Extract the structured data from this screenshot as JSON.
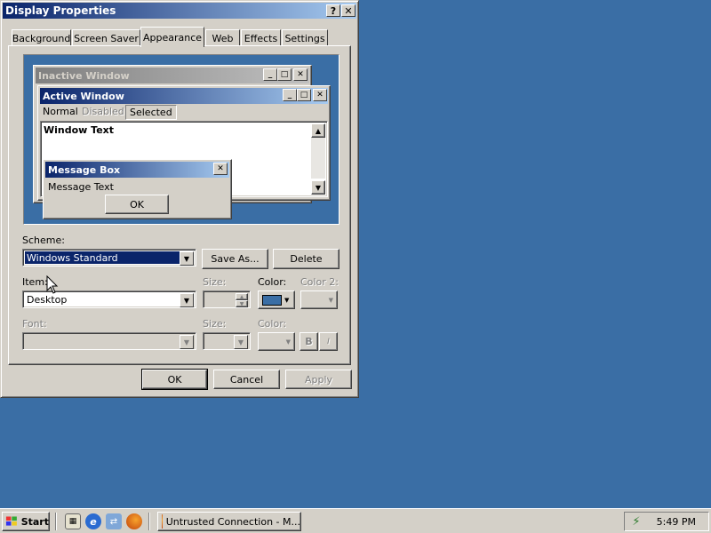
{
  "window": {
    "title": "Display Properties",
    "help_label": "?",
    "close_label": "✕"
  },
  "tabs": [
    {
      "label": "Background",
      "active": false
    },
    {
      "label": "Screen Saver",
      "active": false
    },
    {
      "label": "Appearance",
      "active": true
    },
    {
      "label": "Web",
      "active": false
    },
    {
      "label": "Effects",
      "active": false
    },
    {
      "label": "Settings",
      "active": false
    }
  ],
  "preview": {
    "inactive_title": "Inactive Window",
    "active_title": "Active Window",
    "menu_items": [
      "Normal",
      "Disabled",
      "Selected"
    ],
    "window_text": "Window Text",
    "message_box_title": "Message Box",
    "message_text": "Message Text",
    "ok_label": "OK"
  },
  "scheme": {
    "label": "Scheme:",
    "value": "Windows Standard",
    "save_as_label": "Save As...",
    "delete_label": "Delete"
  },
  "item": {
    "label": "Item:",
    "value": "Desktop",
    "size_label": "Size:",
    "color_label": "Color:",
    "color_value": "#3a6ea5",
    "color2_label": "Color 2:"
  },
  "font": {
    "label": "Font:",
    "size_label": "Size:",
    "color_label": "Color:",
    "bold_label": "B",
    "italic_label": "I"
  },
  "buttons": {
    "ok": "OK",
    "cancel": "Cancel",
    "apply": "Apply"
  },
  "taskbar": {
    "start_label": "Start",
    "task_label": "Untrusted Connection - M...",
    "clock": "5:49 PM",
    "quick_launch": [
      "show-desktop-icon",
      "internet-explorer-icon",
      "network-icon",
      "firefox-icon"
    ]
  },
  "colors": {
    "desktop": "#3a6ea5",
    "title_active_start": "#0a246a",
    "title_active_end": "#a6caf0",
    "face": "#d4d0c8"
  }
}
